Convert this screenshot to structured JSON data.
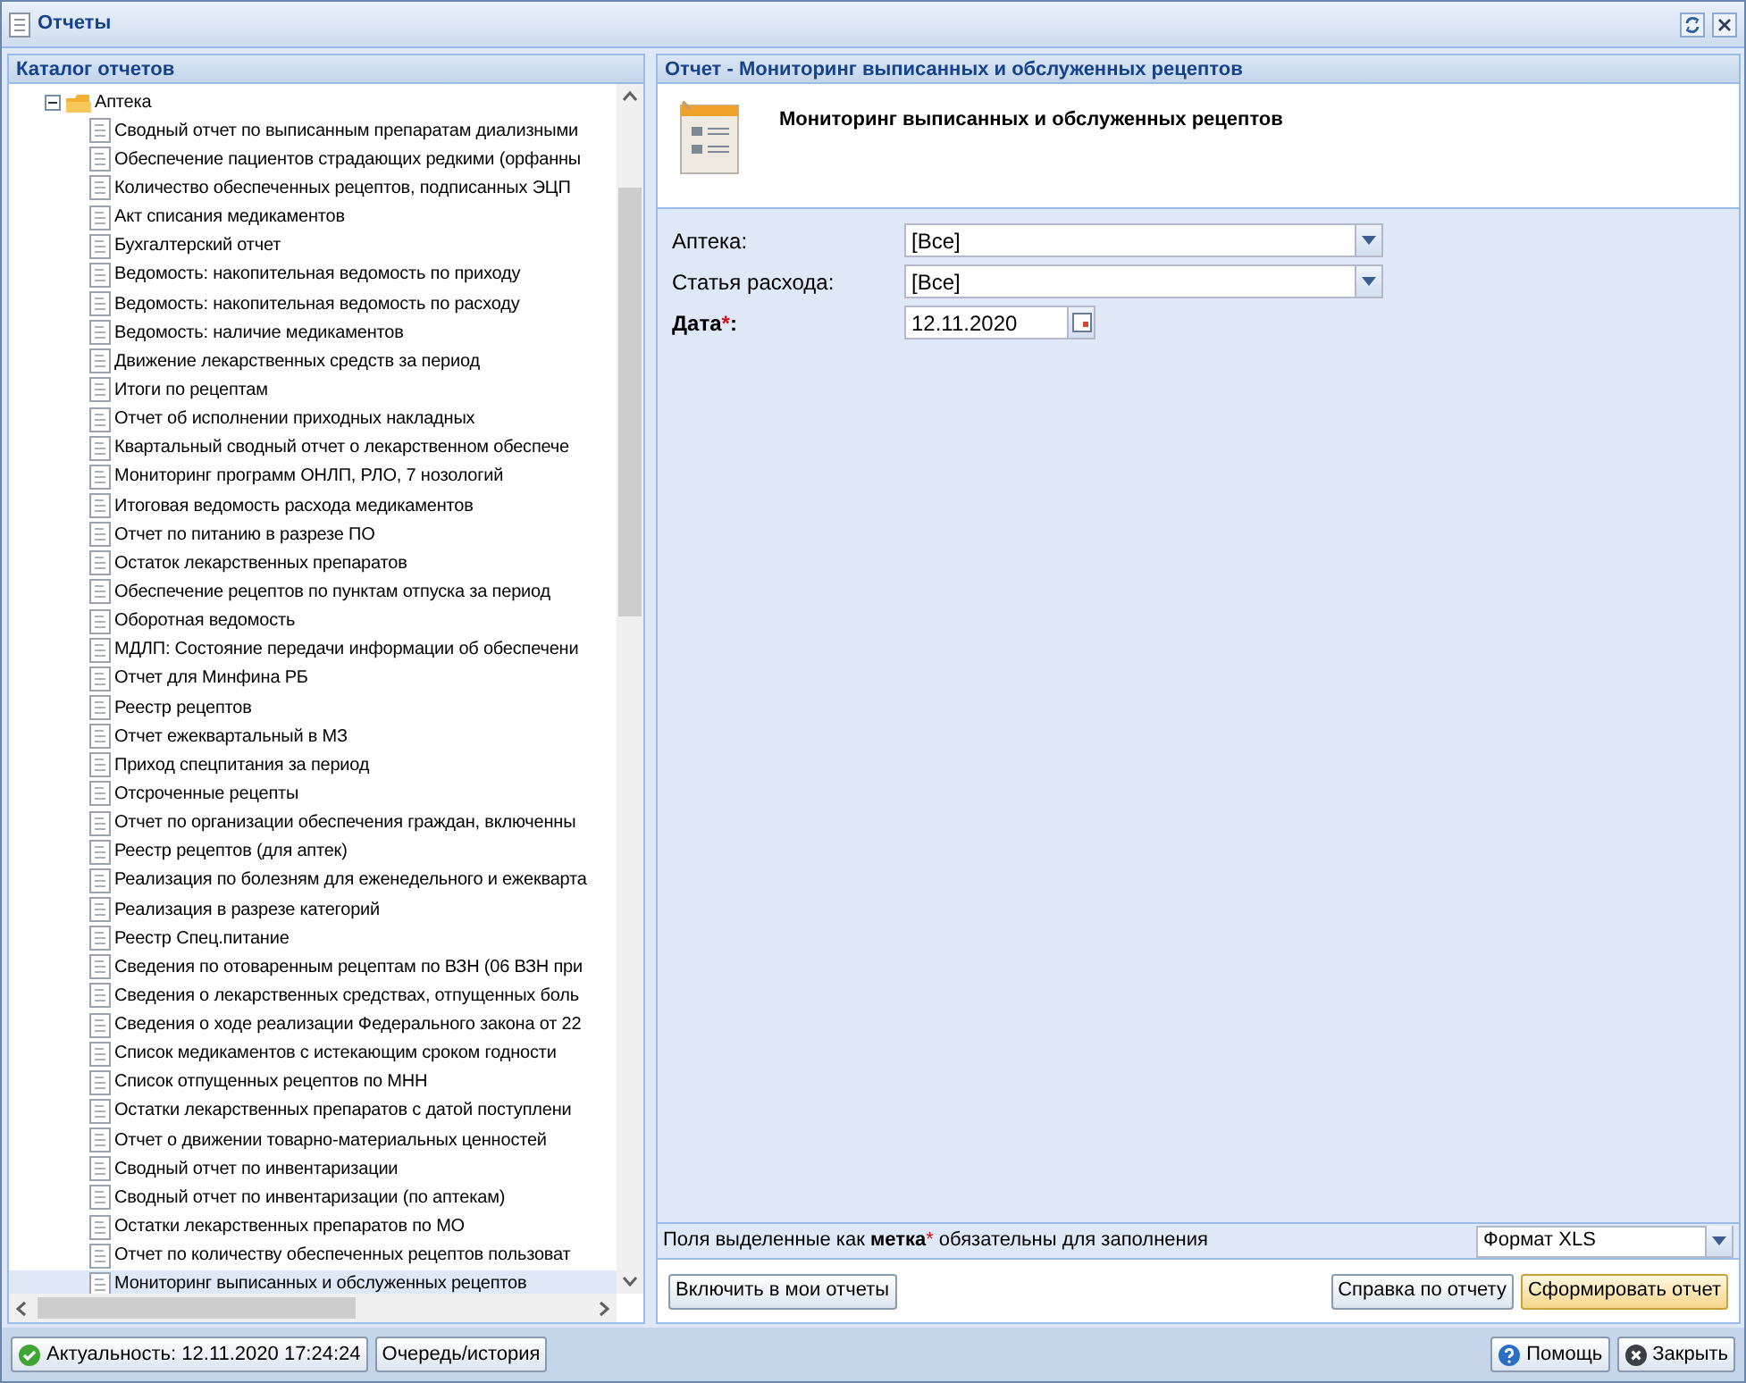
{
  "window": {
    "title": "Отчеты"
  },
  "catalog": {
    "title": "Каталог отчетов",
    "root": {
      "label": "Аптека",
      "expanded": true,
      "children": [
        {
          "label": "Сводный отчет по выписанным препаратам диализными",
          "selected": false
        },
        {
          "label": "Обеспечение пациентов страдающих редкими (орфанны",
          "selected": false
        },
        {
          "label": "Количество обеспеченных рецептов, подписанных ЭЦП",
          "selected": false
        },
        {
          "label": "Акт списания медикаментов",
          "selected": false
        },
        {
          "label": "Бухгалтерский отчет",
          "selected": false
        },
        {
          "label": "Ведомость: накопительная ведомость по приходу",
          "selected": false
        },
        {
          "label": "Ведомость: накопительная ведомость по расходу",
          "selected": false
        },
        {
          "label": "Ведомость: наличие медикаментов",
          "selected": false
        },
        {
          "label": "Движение лекарственных средств за период",
          "selected": false
        },
        {
          "label": "Итоги по рецептам",
          "selected": false
        },
        {
          "label": "Отчет об исполнении приходных накладных",
          "selected": false
        },
        {
          "label": "Квартальный сводный отчет о лекарственном обеспече",
          "selected": false
        },
        {
          "label": "Мониторинг программ ОНЛП, РЛО, 7 нозологий",
          "selected": false
        },
        {
          "label": "Итоговая ведомость расхода медикаментов",
          "selected": false
        },
        {
          "label": "Отчет по питанию в разрезе ПО",
          "selected": false
        },
        {
          "label": "Остаток лекарственных препаратов",
          "selected": false
        },
        {
          "label": "Обеспечение рецептов по пунктам отпуска за период",
          "selected": false
        },
        {
          "label": "Оборотная ведомость",
          "selected": false
        },
        {
          "label": "МДЛП: Состояние передачи информации об обеспечени",
          "selected": false
        },
        {
          "label": "Отчет для Минфина РБ",
          "selected": false
        },
        {
          "label": "Реестр рецептов",
          "selected": false
        },
        {
          "label": "Отчет ежеквартальный в МЗ",
          "selected": false
        },
        {
          "label": "Приход спецпитания за период",
          "selected": false
        },
        {
          "label": "Отсроченные рецепты",
          "selected": false
        },
        {
          "label": "Отчет по организации обеспечения граждан, включенны",
          "selected": false
        },
        {
          "label": "Реестр рецептов (для аптек)",
          "selected": false
        },
        {
          "label": "Реализация по болезням для еженедельного и ежекварта",
          "selected": false
        },
        {
          "label": "Реализация в разрезе категорий",
          "selected": false
        },
        {
          "label": "Реестр Спец.питание",
          "selected": false
        },
        {
          "label": "Сведения по отоваренным рецептам по ВЗН (06 ВЗН при",
          "selected": false
        },
        {
          "label": "Сведения о лекарственных средствах, отпущенных боль",
          "selected": false
        },
        {
          "label": "Сведения о ходе реализации Федерального закона от 22",
          "selected": false
        },
        {
          "label": "Список медикаментов с истекающим сроком годности",
          "selected": false
        },
        {
          "label": "Список отпущенных рецептов по МНН",
          "selected": false
        },
        {
          "label": "Остатки лекарственных препаратов с датой поступлени",
          "selected": false
        },
        {
          "label": "Отчет о движении товарно-материальных ценностей",
          "selected": false
        },
        {
          "label": "Сводный отчет по инвентаризации",
          "selected": false
        },
        {
          "label": "Сводный отчет по инвентаризации (по аптекам)",
          "selected": false
        },
        {
          "label": "Остатки лекарственных препаратов по МО",
          "selected": false
        },
        {
          "label": "Отчет по количеству обеспеченных рецептов пользоват",
          "selected": false
        },
        {
          "label": "Мониторинг выписанных и обслуженных рецептов",
          "selected": true
        }
      ]
    }
  },
  "report": {
    "title": "Отчет - Мониторинг выписанных и обслуженных рецептов",
    "heading": "Мониторинг выписанных и обслуженных рецептов",
    "fields": [
      {
        "kind": "select",
        "label": "Аптека:",
        "value": "[Все]",
        "required": false
      },
      {
        "kind": "select",
        "label": "Статья расхода:",
        "value": "[Все]",
        "required": false
      },
      {
        "kind": "date",
        "label": "Дата",
        "required_mark": "*",
        "colon": ":",
        "value": "12.11.2020",
        "required": true
      }
    ],
    "note": {
      "before": "Поля выделенные как",
      "mark": "метка",
      "star": "*",
      "after": "обязательны для заполнения"
    },
    "format": "Формат XLS",
    "buttons": [
      {
        "label": "Включить в мои отчеты",
        "kind": "plain"
      },
      {
        "label": "Справка по отчету",
        "kind": "plain"
      },
      {
        "label": "Сформировать отчет",
        "kind": "default"
      }
    ]
  },
  "status_bar": {
    "left": [
      {
        "label": "Актуальность: 12.11.2020 17:24:24",
        "kind": "ok"
      },
      {
        "label": "Очередь/история",
        "kind": "plain"
      }
    ],
    "right": [
      {
        "label": "Помощь",
        "kind": "help"
      },
      {
        "label": "Закрыть",
        "kind": "close"
      }
    ]
  }
}
